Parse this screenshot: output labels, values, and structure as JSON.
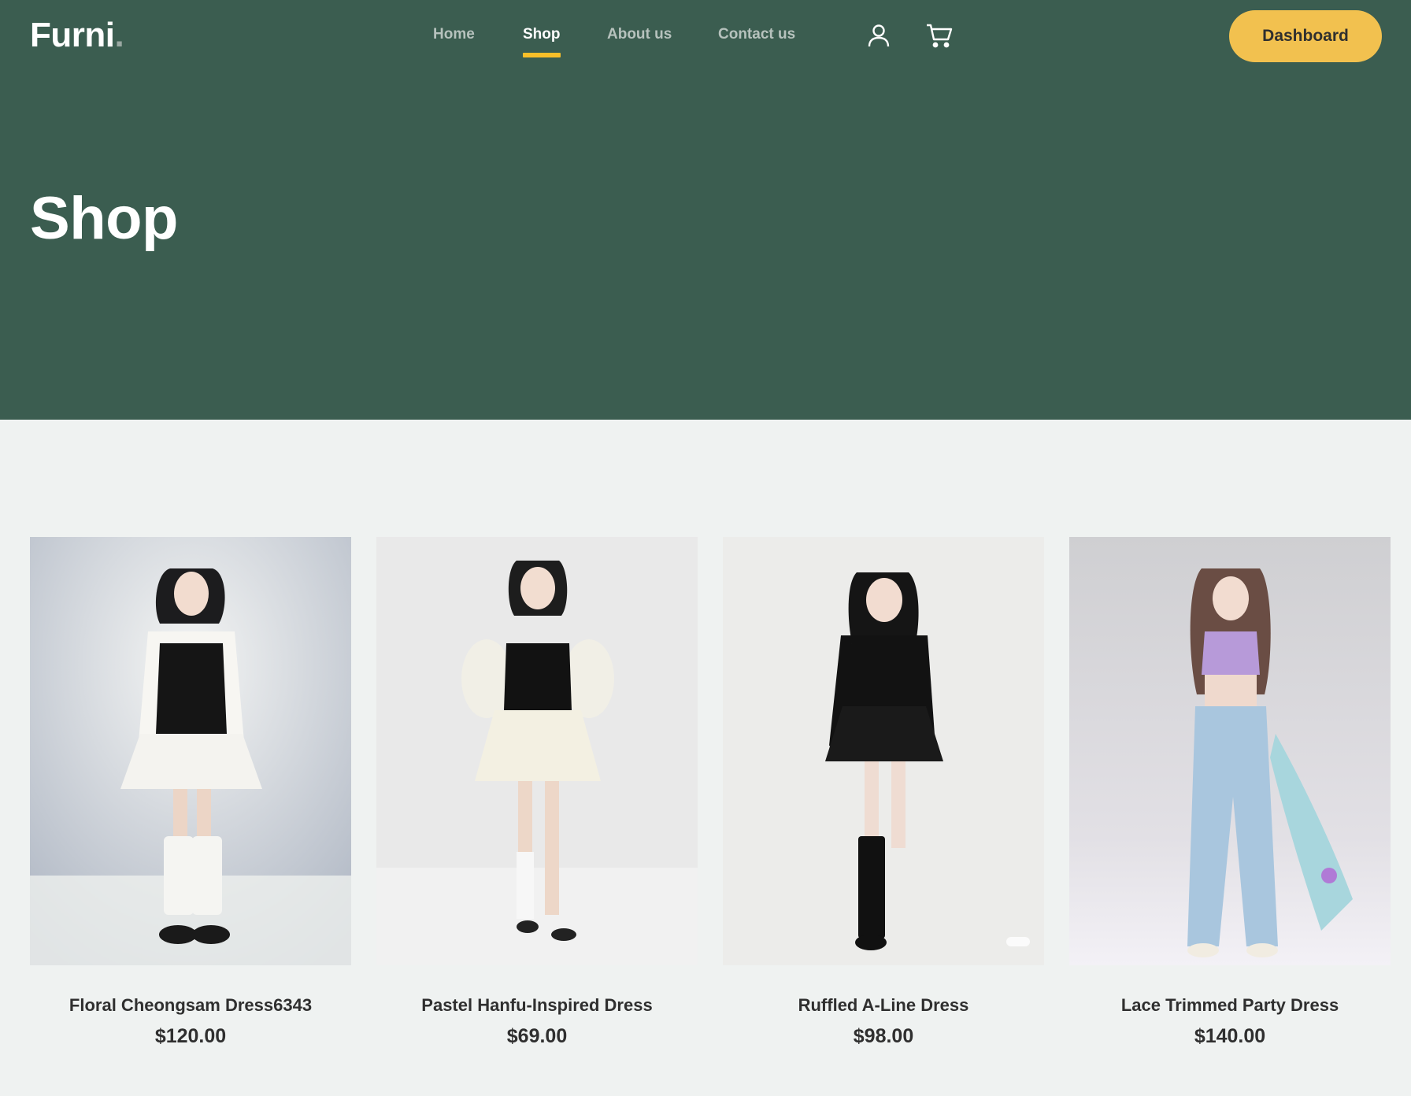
{
  "brand": {
    "name": "Furni",
    "dot": "."
  },
  "nav": {
    "items": [
      {
        "label": "Home"
      },
      {
        "label": "Shop"
      },
      {
        "label": "About us"
      },
      {
        "label": "Contact us"
      }
    ],
    "active": "Shop",
    "user_icon": "user-icon",
    "cart_icon": "cart-icon"
  },
  "dashboard_button": {
    "label": "Dashboard"
  },
  "hero": {
    "title": "Shop"
  },
  "products": [
    {
      "name": "Floral Cheongsam Dress6343",
      "price": "$120.00",
      "image_icon": "product-photo"
    },
    {
      "name": "Pastel Hanfu-Inspired Dress",
      "price": "$69.00",
      "image_icon": "product-photo"
    },
    {
      "name": "Ruffled A-Line Dress",
      "price": "$98.00",
      "image_icon": "product-photo"
    },
    {
      "name": "Lace Trimmed Party Dress",
      "price": "$140.00",
      "image_icon": "product-photo"
    }
  ],
  "colors": {
    "header_bg": "#3b5d50",
    "accent": "#f9bf29",
    "button_bg": "#f2c14f",
    "page_bg": "#eff2f1"
  }
}
